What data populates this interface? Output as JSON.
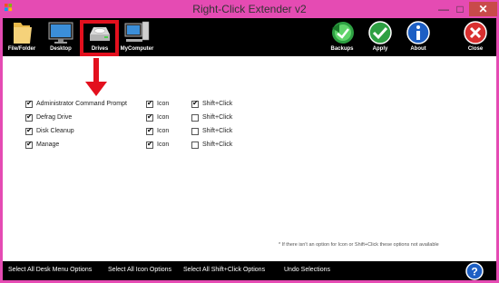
{
  "window": {
    "title": "Right-Click Extender v2",
    "min": "—",
    "max": "□",
    "close": "✕"
  },
  "colors": {
    "frame": "#e54bb3",
    "toolbar": "#000000",
    "highlight": "#e3101e"
  },
  "toolbar": {
    "file_folder": {
      "label": "File/Folder",
      "icon": "folder-icon"
    },
    "desktop": {
      "label": "Desktop",
      "icon": "monitor-icon"
    },
    "drives": {
      "label": "Drives",
      "icon": "drive-icon"
    },
    "mycomputer": {
      "label": "MyComputer",
      "icon": "computer-icon"
    },
    "backups": {
      "label": "Backups",
      "icon": "backup-icon"
    },
    "apply": {
      "label": "Apply",
      "icon": "checkmark-icon"
    },
    "about": {
      "label": "About",
      "icon": "info-icon"
    },
    "close": {
      "label": "Close",
      "icon": "close-icon"
    }
  },
  "options": [
    {
      "label": "Administrator Command Prompt",
      "checked": true,
      "icon_label": "Icon",
      "icon_checked": true,
      "shift_label": "Shift+Click",
      "shift_checked": true
    },
    {
      "label": "Defrag Drive",
      "checked": true,
      "icon_label": "Icon",
      "icon_checked": true,
      "shift_label": "Shift+Click",
      "shift_checked": false
    },
    {
      "label": "Disk Cleanup",
      "checked": true,
      "icon_label": "Icon",
      "icon_checked": true,
      "shift_label": "Shift+Click",
      "shift_checked": false
    },
    {
      "label": "Manage",
      "checked": true,
      "icon_label": "Icon",
      "icon_checked": true,
      "shift_label": "Shift+Click",
      "shift_checked": false
    }
  ],
  "note": "* If there isn't an option for Icon or Shift+Click these options not available",
  "bottom": {
    "select_desk": "Select All Desk Menu Options",
    "select_icon": "Select All Icon Options",
    "select_shift": "Select All Shift+Click Options",
    "undo": "Undo Selections",
    "help": "?"
  }
}
